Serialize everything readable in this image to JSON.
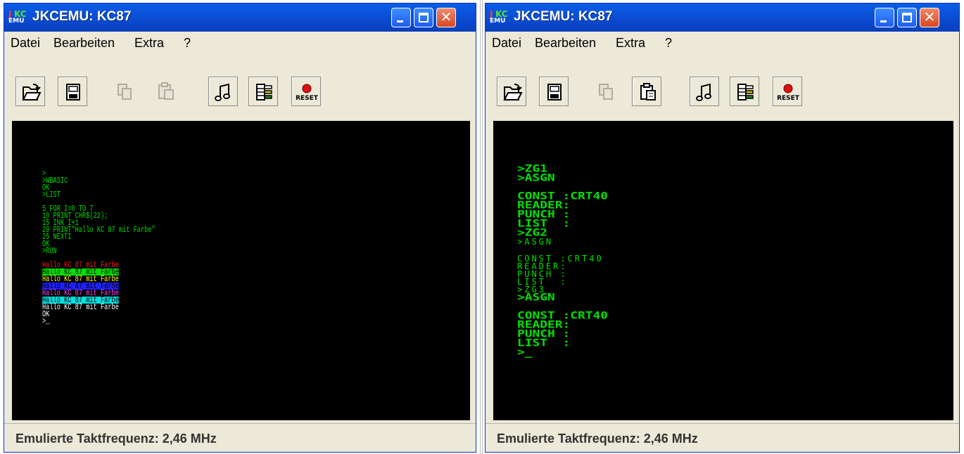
{
  "windows": [
    {
      "title": "JKCEMU: KC87",
      "menu": [
        "Datei",
        "Bearbeiten",
        "Extra",
        "?"
      ],
      "toolbar": [
        {
          "icon": "open-icon"
        },
        {
          "icon": "save-icon"
        },
        {
          "icon": "copy-icon"
        },
        {
          "icon": "paste-icon"
        },
        {
          "icon": "audio-icon"
        },
        {
          "icon": "keyboard-icon"
        },
        {
          "icon": "reset-icon",
          "label": "RESET"
        }
      ],
      "screen": [
        {
          "text": ">",
          "color": "#00e000"
        },
        {
          "text": ">WBASIC",
          "color": "#00e000"
        },
        {
          "text": "OK",
          "color": "#00e000"
        },
        {
          "text": ">LIST",
          "color": "#00e000"
        },
        {
          "text": "",
          "color": "#00e000"
        },
        {
          "text": "5 FOR I=0 TO 7",
          "color": "#00e000"
        },
        {
          "text": "10 PRINT CHR$(22);",
          "color": "#00e000"
        },
        {
          "text": "15 INK I+1",
          "color": "#00e000"
        },
        {
          "text": "20 PRINT\"Hallo KC 87 mit Farbe\"",
          "color": "#00e000"
        },
        {
          "text": "25 NEXTI",
          "color": "#00e000"
        },
        {
          "text": "OK",
          "color": "#00e000"
        },
        {
          "text": ">RUN",
          "color": "#00e000"
        },
        {
          "text": "",
          "color": "#00e000"
        },
        {
          "text": "Hallo KC 87 mit Farbe",
          "color": "#ff1a1a",
          "bg": "#000000"
        },
        {
          "text": "Hallo KC 87 mit Farbe",
          "color": "#000000",
          "bg": "#00e000"
        },
        {
          "text": "Hallo KC 87 mit Farbe",
          "color": "#ffff00",
          "bg": "#000000"
        },
        {
          "text": "Hallo KC 87 mit Farbe",
          "color": "#000000",
          "bg": "#2020ff"
        },
        {
          "text": "Hallo KC 87 mit Farbe",
          "color": "#ff40ff",
          "bg": "#000000"
        },
        {
          "text": "Hallo KC 87 mit Farbe",
          "color": "#000000",
          "bg": "#00e0e0"
        },
        {
          "text": "Hallo KC 87 mit Farbe",
          "color": "#ffffff",
          "bg": "#000000"
        },
        {
          "text": "OK",
          "color": "#ffffff"
        },
        {
          "text": ">_",
          "color": "#ffffff"
        }
      ],
      "status": "Emulierte Taktfrequenz: 2,46 MHz"
    },
    {
      "title": "JKCEMU: KC87",
      "menu": [
        "Datei",
        "Bearbeiten",
        "Extra",
        "?"
      ],
      "toolbar": [
        {
          "icon": "open-icon"
        },
        {
          "icon": "save-icon"
        },
        {
          "icon": "copy-icon"
        },
        {
          "icon": "paste-icon"
        },
        {
          "icon": "audio-icon"
        },
        {
          "icon": "keyboard-icon"
        },
        {
          "icon": "reset-icon",
          "label": "RESET"
        }
      ],
      "screen": [
        {
          "text": ">ZG1",
          "style": "big"
        },
        {
          "text": ">ASGN",
          "style": "big"
        },
        {
          "text": "",
          "style": "gap"
        },
        {
          "text": "CONST :CRT40",
          "style": "big"
        },
        {
          "text": "READER:",
          "style": "big"
        },
        {
          "text": "PUNCH :",
          "style": "big"
        },
        {
          "text": "LIST  :",
          "style": "big"
        },
        {
          "text": ">ZG2",
          "style": "big"
        },
        {
          "text": ">ASGN",
          "style": "small"
        },
        {
          "text": "",
          "style": "gap"
        },
        {
          "text": "CONST :CRT40",
          "style": "small"
        },
        {
          "text": "READER:",
          "style": "small"
        },
        {
          "text": "PUNCH :",
          "style": "small"
        },
        {
          "text": "LIST  :",
          "style": "small"
        },
        {
          "text": ">ZG3",
          "style": "small"
        },
        {
          "text": ">ASGN",
          "style": "big"
        },
        {
          "text": "",
          "style": "gap"
        },
        {
          "text": "CONST :CRT40",
          "style": "big"
        },
        {
          "text": "READER:",
          "style": "big"
        },
        {
          "text": "PUNCH :",
          "style": "big"
        },
        {
          "text": "LIST  :",
          "style": "big"
        },
        {
          "text": ">_",
          "style": "big"
        }
      ],
      "status": "Emulierte Taktfrequenz: 2,46 MHz"
    }
  ],
  "colors": {
    "title_bar": "#0b4fd6",
    "window_bg": "#ece9d8",
    "screen_bg": "#000000",
    "screen_text": "#00e000",
    "close_button": "#d9461f"
  }
}
